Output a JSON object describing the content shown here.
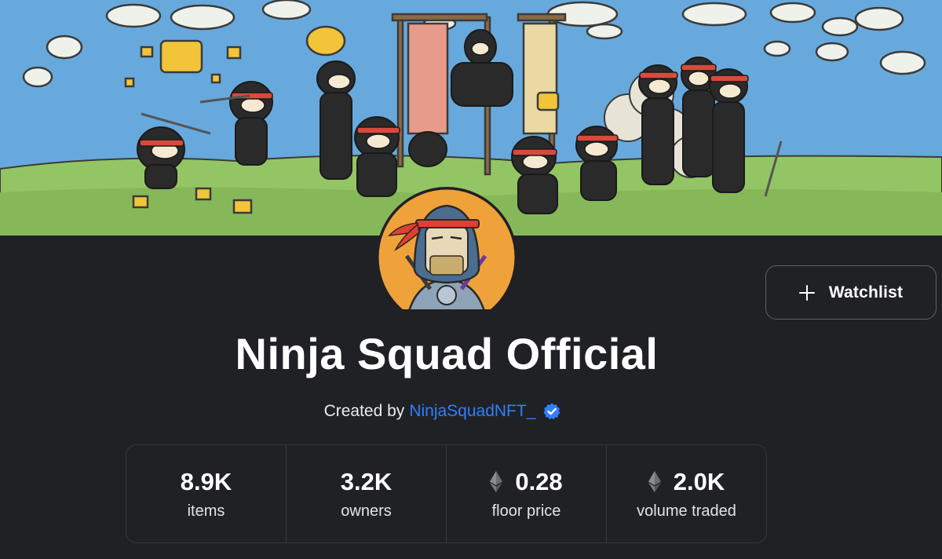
{
  "collection": {
    "name": "Ninja Squad Official",
    "created_by_prefix": "Created by",
    "creator": "NinjaSquadNFT_",
    "verified": true
  },
  "actions": {
    "watchlist_label": "Watchlist",
    "watchlist_icon": "plus-icon"
  },
  "stats": [
    {
      "value": "8.9K",
      "label": "items",
      "icon": ""
    },
    {
      "value": "3.2K",
      "label": "owners",
      "icon": ""
    },
    {
      "value": "0.28",
      "label": "floor price",
      "icon": "ethereum-icon"
    },
    {
      "value": "2.0K",
      "label": "volume traded",
      "icon": "ethereum-icon"
    }
  ],
  "colors": {
    "background": "#202125",
    "creator_link": "#2f80ff",
    "verified_badge": "#2f80ff",
    "sky": "#67a9dc",
    "grass": "#94c564",
    "avatar_bg": "#f0a23a"
  }
}
